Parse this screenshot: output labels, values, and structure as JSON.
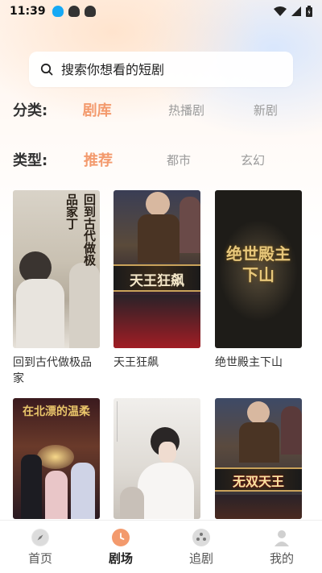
{
  "status_bar": {
    "time": "11:39"
  },
  "search": {
    "placeholder": "搜索你想看的短剧"
  },
  "category": {
    "label": "分类:",
    "options": [
      "剧库",
      "热播剧",
      "新剧"
    ],
    "active": "剧库"
  },
  "genre": {
    "label": "类型:",
    "options": [
      "推荐",
      "都市",
      "玄幻"
    ],
    "active": "推荐"
  },
  "dramas": [
    {
      "title": "回到古代做极品家",
      "poster_text": "回到古代做极品家丁"
    },
    {
      "title": "天王狂飙",
      "poster_text": "天王狂飙"
    },
    {
      "title": "绝世殿主下山",
      "poster_text": "绝世殿主下山"
    },
    {
      "title": "",
      "poster_text": "在北漂的温柔"
    },
    {
      "title": "",
      "poster_text": ""
    },
    {
      "title": "",
      "poster_text": "无双天王"
    }
  ],
  "tabbar": {
    "items": [
      {
        "label": "首页",
        "icon": "compass-icon"
      },
      {
        "label": "剧场",
        "icon": "clock-icon"
      },
      {
        "label": "追剧",
        "icon": "film-reel-icon"
      },
      {
        "label": "我的",
        "icon": "user-icon"
      }
    ],
    "active": "剧场"
  },
  "colors": {
    "accent": "#f39a6d",
    "text": "#333333",
    "muted": "#9a9a9a"
  }
}
